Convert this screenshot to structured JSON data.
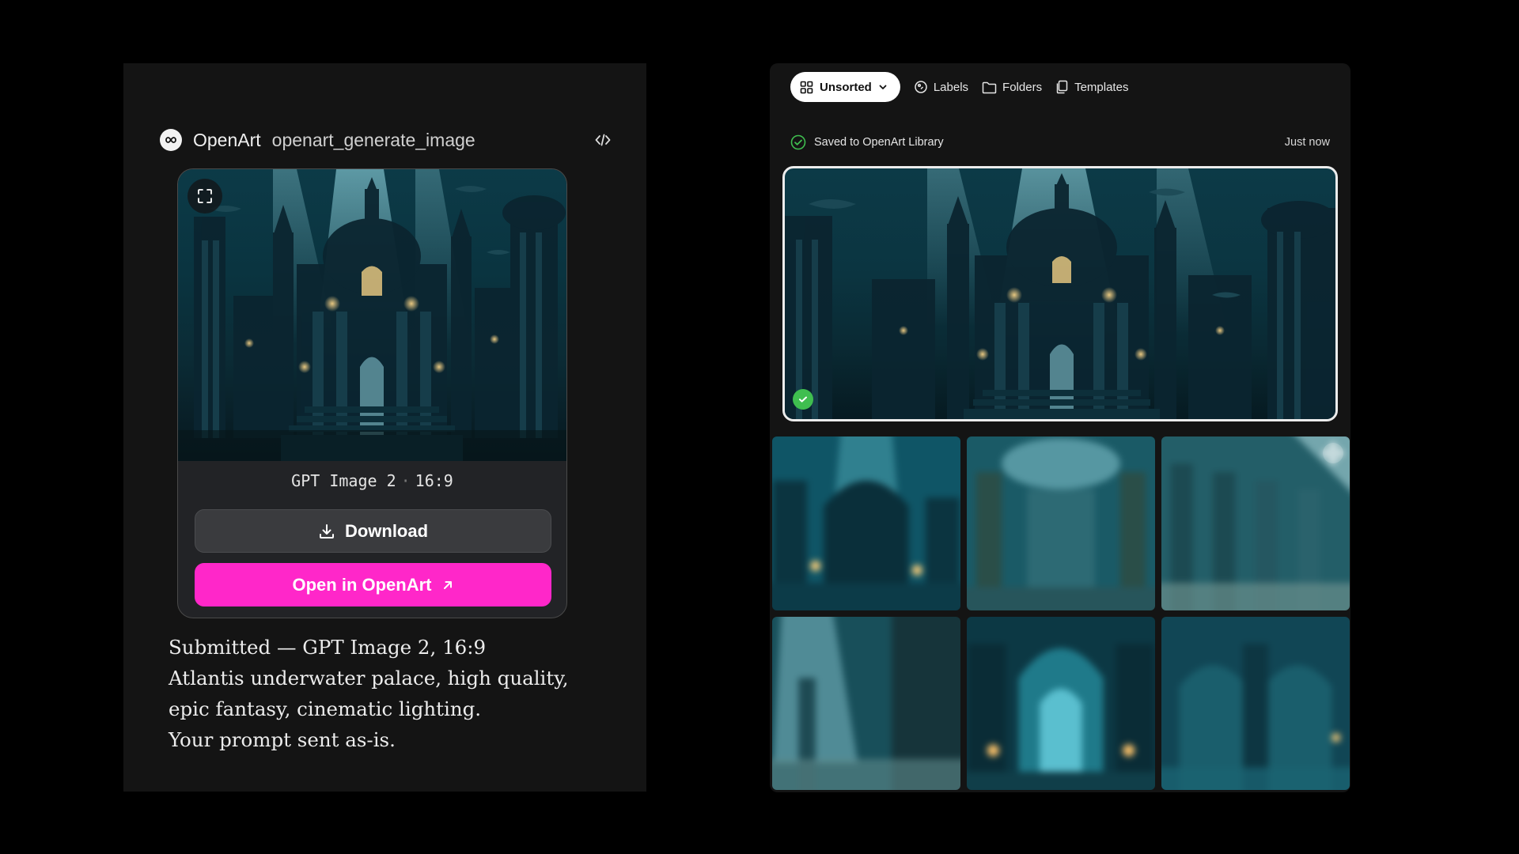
{
  "chat": {
    "app_name": "OpenArt",
    "tool_name": "openart_generate_image",
    "icons": {
      "logo": "openart-logo-icon",
      "code": "code-icon",
      "expand": "expand-icon",
      "download": "download-icon",
      "external": "external-link-icon"
    },
    "widget": {
      "model": "GPT Image 2",
      "aspect": "16:9",
      "download_label": "Download",
      "open_label": "Open in OpenArt",
      "accent": "#ff27c9"
    },
    "summary": [
      "Submitted — GPT Image 2, 16:9",
      "Atlantis underwater palace, high quality,",
      "epic fantasy, cinematic lighting.",
      "Your prompt sent as-is."
    ]
  },
  "library": {
    "toolbar": {
      "sort_label": "Unsorted",
      "labels_label": "Labels",
      "folders_label": "Folders",
      "templates_label": "Templates"
    },
    "status": {
      "text": "Saved to OpenArt Library",
      "time": "Just now",
      "color": "#3fbe4f"
    },
    "icons": {
      "grid": "grid-icon",
      "chevron": "chevron-down-icon",
      "labels": "tag-icon",
      "folders": "folder-icon",
      "templates": "templates-icon",
      "check": "check-circle-icon",
      "move": "move-icon"
    },
    "thumbnail_count": 6
  }
}
